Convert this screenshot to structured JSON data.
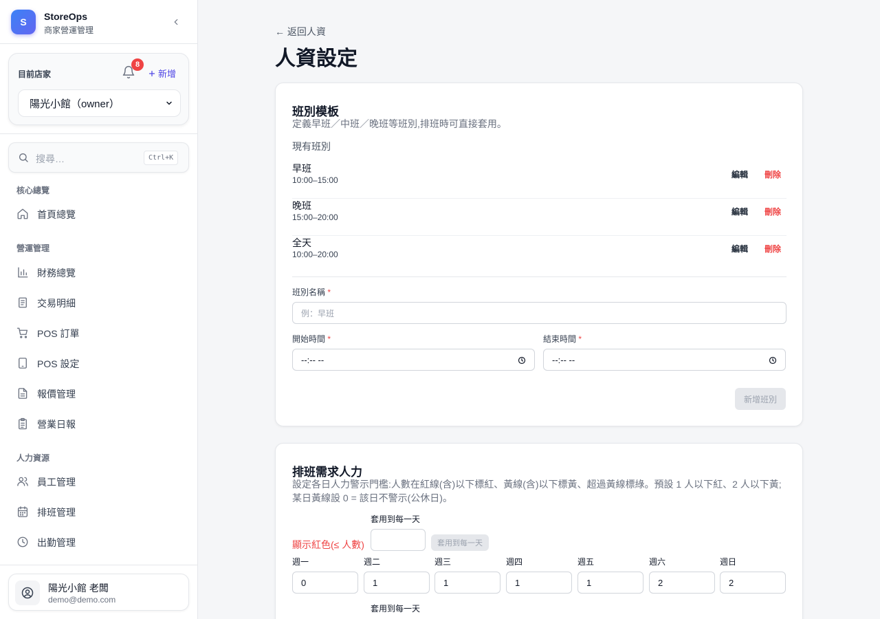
{
  "brand": {
    "logo_letter": "S",
    "name": "StoreOps",
    "subtitle": "商家營運管理"
  },
  "store": {
    "label": "目前店家",
    "notification_count": "8",
    "add_label": "新增",
    "selected": "陽光小館（owner）"
  },
  "search": {
    "placeholder": "搜尋…",
    "shortcut": "Ctrl+K"
  },
  "nav": {
    "sections": [
      {
        "title": "核心總覽",
        "items": [
          {
            "label": "首頁總覽",
            "icon": "home-icon"
          }
        ]
      },
      {
        "title": "營運管理",
        "items": [
          {
            "label": "財務總覽",
            "icon": "bar-chart-icon"
          },
          {
            "label": "交易明細",
            "icon": "receipt-icon"
          },
          {
            "label": "POS 訂單",
            "icon": "cart-icon"
          },
          {
            "label": "POS 設定",
            "icon": "tablet-icon"
          },
          {
            "label": "報價管理",
            "icon": "file-text-icon"
          },
          {
            "label": "營業日報",
            "icon": "clipboard-icon"
          }
        ]
      },
      {
        "title": "人力資源",
        "items": [
          {
            "label": "員工管理",
            "icon": "users-icon"
          },
          {
            "label": "排班管理",
            "icon": "calendar-icon"
          },
          {
            "label": "出勤管理",
            "icon": "clock-icon"
          }
        ]
      }
    ]
  },
  "user": {
    "name": "陽光小館 老闆",
    "email": "demo@demo.com"
  },
  "page": {
    "back_label": "← 返回人資",
    "title": "人資設定"
  },
  "shift_template": {
    "title": "班別模板",
    "description": "定義早班／中班／晚班等班別,排班時可直接套用。",
    "existing_label": "現有班別",
    "edit_label": "編輯",
    "delete_label": "刪除",
    "shifts": [
      {
        "name": "早班",
        "time": "10:00–15:00"
      },
      {
        "name": "晚班",
        "time": "15:00–20:00"
      },
      {
        "name": "全天",
        "time": "10:00–20:00"
      }
    ],
    "form": {
      "name_label": "班別名稱",
      "name_placeholder": "例：早班",
      "start_label": "開始時間",
      "end_label": "結束時間",
      "start_value": "--:-- --",
      "end_value": "--:-- --",
      "required_mark": "*",
      "submit_label": "新增班別"
    }
  },
  "staffing": {
    "title": "排班需求人力",
    "description": "設定各日人力警示門檻:人數在紅線(含)以下標紅、黃線(含)以下標黃、超過黃線標綠。預設 1 人以下紅、2 人以下黃;某日黃線設 0 = 該日不警示(公休日)。",
    "apply_label": "套用到每一天",
    "apply_button": "套用到每一天",
    "red_label": "顯示紅色(≤ 人數)",
    "days": [
      "週一",
      "週二",
      "週三",
      "週四",
      "週五",
      "週六",
      "週日"
    ],
    "red_values": [
      "0",
      "1",
      "1",
      "1",
      "1",
      "2",
      "2"
    ]
  },
  "colors": {
    "accent": "#4f46e5",
    "danger": "#ef4444",
    "badge": "#ef4444"
  }
}
